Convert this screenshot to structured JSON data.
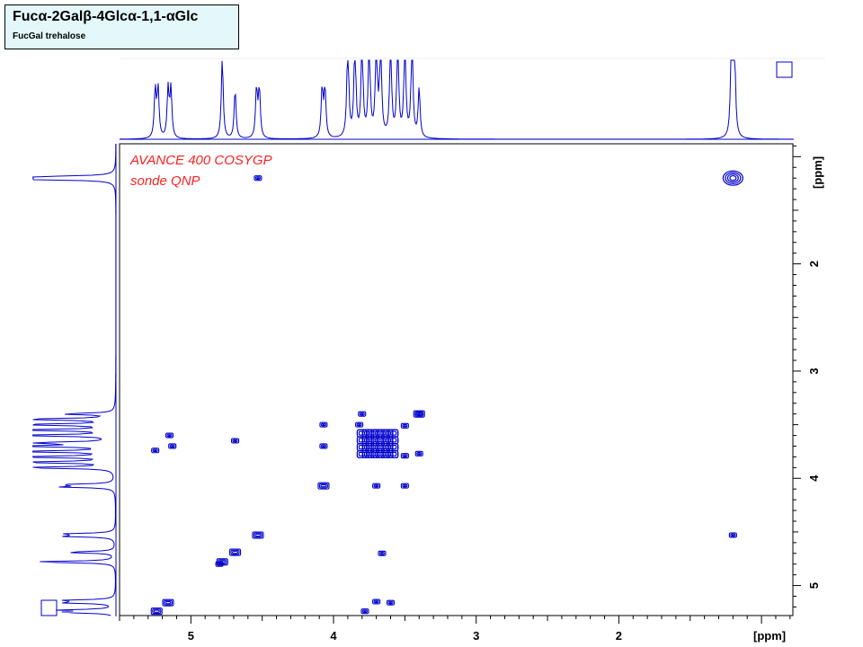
{
  "header": {
    "title": "Fucα-2Galβ-4Glcα-1,1-αGlc",
    "subtitle": "FucGal  trehalose"
  },
  "colors": {
    "spectrum": "#0000cc",
    "annotation": "#ff2020",
    "axis": "#000000",
    "title_bg": "#e4f8fb"
  },
  "annotations": [
    "AVANCE 400 COSYGP",
    "sonde QNP"
  ],
  "chart_data": {
    "type": "scatter",
    "subtype": "2D COSY contour plot",
    "x_axis": {
      "label": "[ppm]",
      "range": [
        5.5,
        0.78
      ],
      "reversed": true,
      "ticks": [
        5,
        4,
        3,
        2
      ]
    },
    "y_axis": {
      "label": "[ppm]",
      "range": [
        0.88,
        5.28
      ],
      "reversed": true,
      "ticks": [
        2,
        3,
        4,
        5
      ],
      "position": "right"
    },
    "grid": false,
    "diagonal_peaks": [
      {
        "x": 5.24,
        "y": 5.24
      },
      {
        "x": 5.16,
        "y": 5.16
      },
      {
        "x": 4.78,
        "y": 4.78
      },
      {
        "x": 4.69,
        "y": 4.69
      },
      {
        "x": 4.53,
        "y": 4.53
      },
      {
        "x": 4.07,
        "y": 4.07
      },
      {
        "x": 3.77,
        "y": 3.77
      },
      {
        "x": 3.67,
        "y": 3.67
      },
      {
        "x": 3.4,
        "y": 3.4
      },
      {
        "x": 1.2,
        "y": 1.2
      }
    ],
    "cross_peaks": [
      {
        "x": 4.53,
        "y": 1.2
      },
      {
        "x": 1.2,
        "y": 4.53
      },
      {
        "x": 5.15,
        "y": 3.6
      },
      {
        "x": 5.13,
        "y": 3.7
      },
      {
        "x": 5.25,
        "y": 3.74
      },
      {
        "x": 4.69,
        "y": 3.65
      },
      {
        "x": 4.07,
        "y": 3.5
      },
      {
        "x": 4.07,
        "y": 3.7
      },
      {
        "x": 3.8,
        "y": 3.4
      },
      {
        "x": 3.82,
        "y": 3.5
      },
      {
        "x": 3.7,
        "y": 4.07
      },
      {
        "x": 3.5,
        "y": 4.07
      },
      {
        "x": 3.5,
        "y": 3.51
      },
      {
        "x": 3.5,
        "y": 3.79
      },
      {
        "x": 3.4,
        "y": 3.4
      },
      {
        "x": 3.4,
        "y": 3.77
      },
      {
        "x": 3.66,
        "y": 4.7
      },
      {
        "x": 4.8,
        "y": 4.8
      },
      {
        "x": 3.7,
        "y": 5.15
      },
      {
        "x": 3.6,
        "y": 5.16
      },
      {
        "x": 3.78,
        "y": 5.24
      }
    ],
    "projection_peaks_ppm": [
      5.25,
      5.23,
      5.16,
      5.14,
      4.78,
      4.69,
      4.54,
      4.52,
      4.08,
      4.06,
      3.9,
      3.85,
      3.8,
      3.75,
      3.7,
      3.67,
      3.6,
      3.55,
      3.5,
      3.45,
      3.4,
      1.21,
      1.19
    ]
  }
}
